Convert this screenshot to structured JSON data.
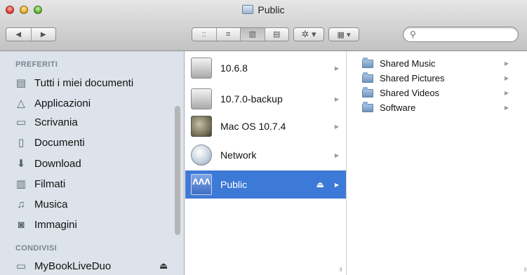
{
  "window": {
    "title": "Public"
  },
  "toolbar": {
    "back_glyph": "◀",
    "forward_glyph": "▶",
    "view_modes": [
      "::",
      "≡",
      "▥",
      "▤"
    ],
    "active_view_mode": 2,
    "action_glyph": "✲ ▾",
    "arrange_glyph": "▦ ▾",
    "search_icon": "⚲"
  },
  "sidebar": {
    "sections": [
      {
        "title": "PREFERITI",
        "items": [
          {
            "label": "Tutti i miei documenti",
            "icon": "all-files-icon"
          },
          {
            "label": "Applicazioni",
            "icon": "applications-icon"
          },
          {
            "label": "Scrivania",
            "icon": "desktop-icon"
          },
          {
            "label": "Documenti",
            "icon": "documents-icon"
          },
          {
            "label": "Download",
            "icon": "download-icon"
          },
          {
            "label": "Filmati",
            "icon": "movies-icon"
          },
          {
            "label": "Musica",
            "icon": "music-icon"
          },
          {
            "label": "Immagini",
            "icon": "pictures-icon"
          }
        ]
      },
      {
        "title": "CONDIVISI",
        "items": [
          {
            "label": "MyBookLiveDuo",
            "icon": "network-drive-icon",
            "eject": "⏏"
          }
        ]
      }
    ]
  },
  "column1": {
    "items": [
      {
        "label": "10.6.8",
        "icon": "hard-drive-icon",
        "selected": false
      },
      {
        "label": "10.7.0-backup",
        "icon": "hard-drive-icon",
        "selected": false
      },
      {
        "label": "Mac OS 10.7.4",
        "icon": "mac-os-disk-icon",
        "selected": false
      },
      {
        "label": "Network",
        "icon": "network-globe-icon",
        "selected": false
      },
      {
        "label": "Public",
        "icon": "shared-folder-icon",
        "selected": true,
        "eject": "⏏"
      }
    ]
  },
  "column2": {
    "items": [
      {
        "label": "Shared Music"
      },
      {
        "label": "Shared Pictures"
      },
      {
        "label": "Shared Videos"
      },
      {
        "label": "Software"
      }
    ]
  },
  "colors": {
    "selection": "#3d79d6",
    "sidebar_bg": "#dce3ea",
    "section_header": "#7a8694"
  }
}
